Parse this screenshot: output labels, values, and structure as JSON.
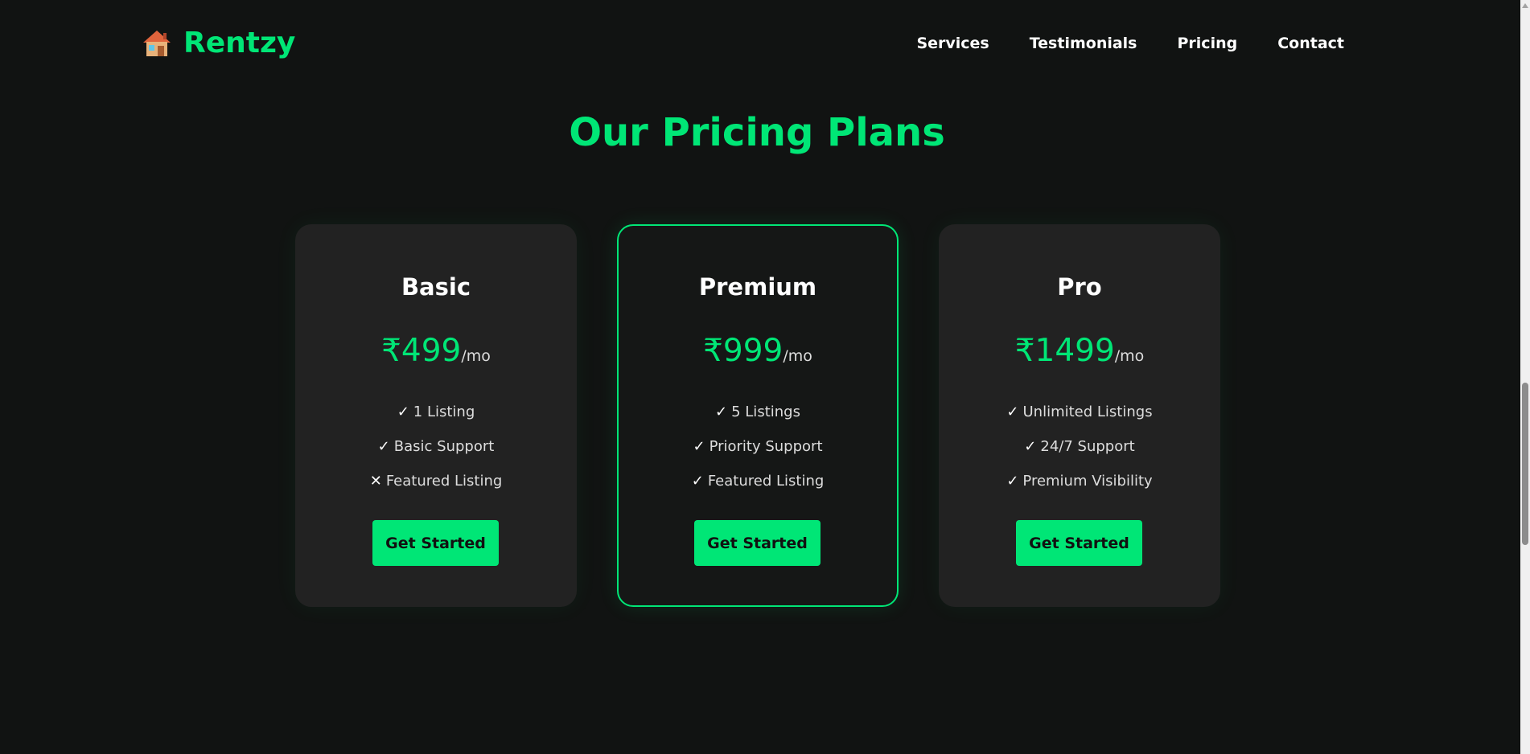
{
  "brand": {
    "name": "Rentzy",
    "icon": "house-icon"
  },
  "nav": {
    "links": [
      {
        "label": "Services"
      },
      {
        "label": "Testimonials"
      },
      {
        "label": "Pricing"
      },
      {
        "label": "Contact"
      }
    ]
  },
  "pricing": {
    "title": "Our Pricing Plans",
    "plans": [
      {
        "name": "Basic",
        "price": "₹499",
        "period": "/mo",
        "featured": false,
        "features": [
          {
            "mark": "✓",
            "text": "1 Listing"
          },
          {
            "mark": "✕",
            "text": "Featured Listing",
            "mark_is_cross": true
          },
          {
            "mark": "✓",
            "text": "Basic Support"
          }
        ],
        "cta": "Get Started"
      },
      {
        "name": "Premium",
        "price": "₹999",
        "period": "/mo",
        "featured": true,
        "features": [
          {
            "mark": "✓",
            "text": "5 Listings"
          },
          {
            "mark": "✓",
            "text": "Priority Support"
          },
          {
            "mark": "✓",
            "text": "Featured Listing"
          }
        ],
        "cta": "Get Started"
      },
      {
        "name": "Pro",
        "price": "₹1499",
        "period": "/mo",
        "featured": false,
        "features": [
          {
            "mark": "✓",
            "text": "Unlimited Listings"
          },
          {
            "mark": "✓",
            "text": "24/7 Support"
          },
          {
            "mark": "✓",
            "text": "Premium Visibility"
          }
        ],
        "cta": "Get Started"
      }
    ]
  },
  "colors": {
    "accent": "#00e676",
    "background": "#111312",
    "card": "#222222"
  }
}
